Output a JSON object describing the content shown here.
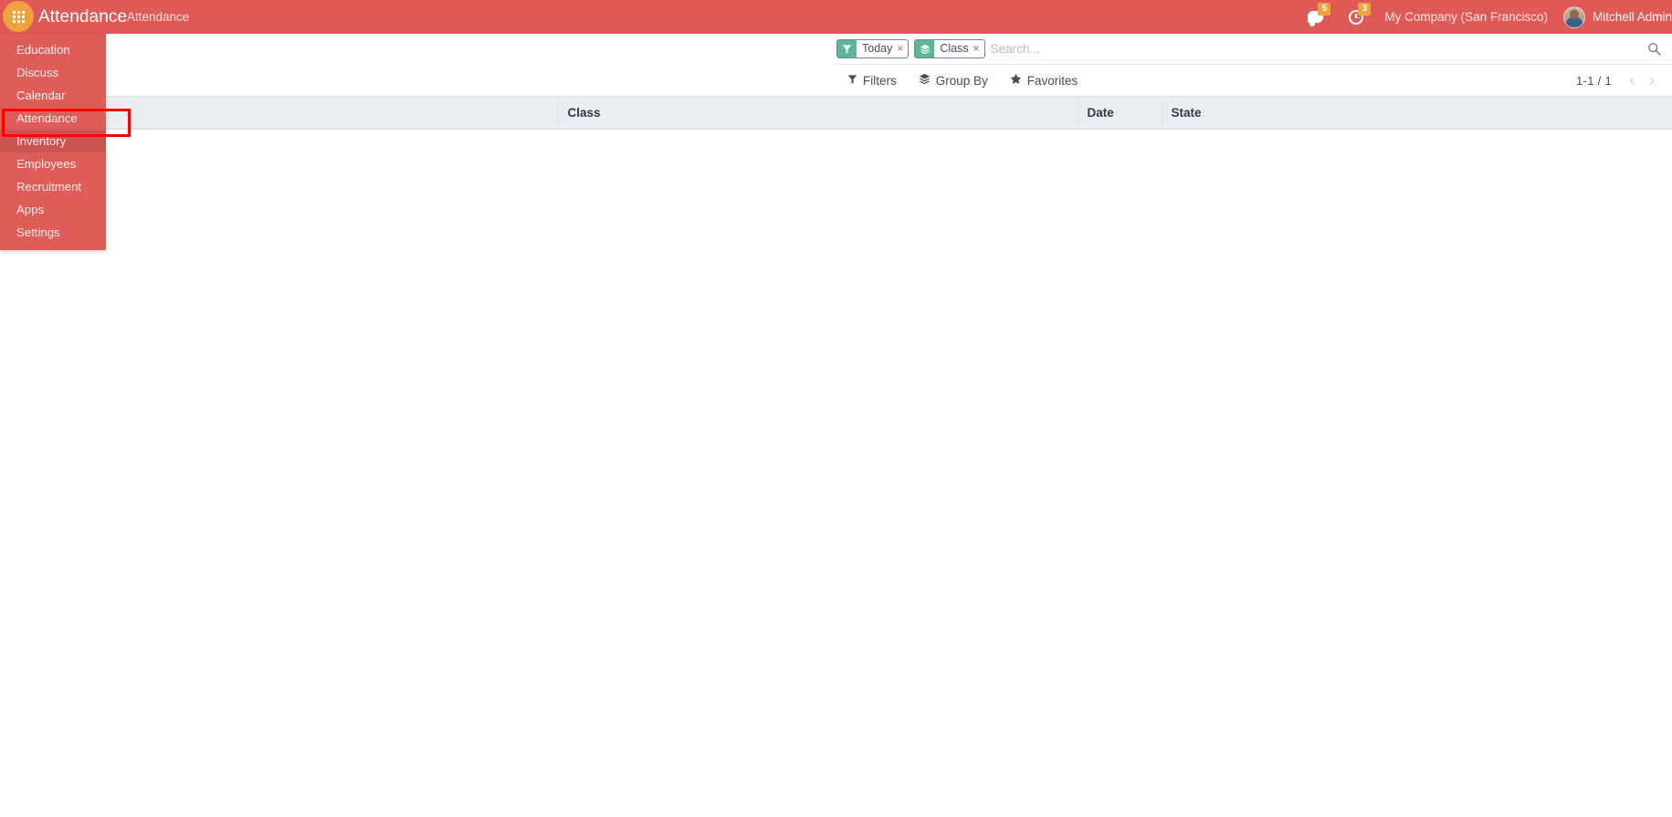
{
  "navbar": {
    "apps_toggle_icon": "apps-grid-icon",
    "brand": "Attendance",
    "menu_item": "Attendance",
    "messages": {
      "icon": "chat-bubble-icon",
      "count": "5"
    },
    "activities": {
      "icon": "clock-icon",
      "count": "3"
    },
    "company": "My Company (San Francisco)",
    "user": {
      "name": "Mitchell Admin",
      "avatar": "user-avatar"
    }
  },
  "apps_menu": {
    "items": [
      {
        "label": "Education",
        "state": "normal"
      },
      {
        "label": "Discuss",
        "state": "normal"
      },
      {
        "label": "Calendar",
        "state": "normal"
      },
      {
        "label": "Attendance",
        "state": "highlighted"
      },
      {
        "label": "Inventory",
        "state": "hover"
      },
      {
        "label": "Employees",
        "state": "normal"
      },
      {
        "label": "Recruitment",
        "state": "normal"
      },
      {
        "label": "Apps",
        "state": "normal"
      },
      {
        "label": "Settings",
        "state": "normal"
      }
    ]
  },
  "annotation": {
    "target": "Attendance",
    "color": "#ff0000"
  },
  "search": {
    "placeholder": "Search...",
    "value": "",
    "magnifier_icon": "search-icon",
    "facets": [
      {
        "icon": "filter-icon",
        "label": "Today",
        "remove": "×"
      },
      {
        "icon": "group-by-icon",
        "label": "Class",
        "remove": "×"
      }
    ]
  },
  "control_panel": {
    "buttons": [
      {
        "icon": "filter-icon",
        "label": "Filters"
      },
      {
        "icon": "group-by-icon",
        "label": "Group By"
      },
      {
        "icon": "star-icon",
        "label": "Favorites"
      }
    ],
    "pager": {
      "value": "1-1 / 1",
      "previous_icon": "chevron-left-icon",
      "next_icon": "chevron-right-icon"
    }
  },
  "list_view": {
    "columns": [
      "",
      "Class",
      "Date",
      "State"
    ],
    "rows": []
  },
  "colors": {
    "navbar_bg": "#df5a56",
    "apps_menu_bg": "#e05c58",
    "apps_toggle_bg": "#f0a23c",
    "facet_icon_bg": "#5cb894",
    "facet_border": "#7c7bad",
    "table_header_bg": "#eaeef0",
    "annotation": "#ff0000"
  }
}
